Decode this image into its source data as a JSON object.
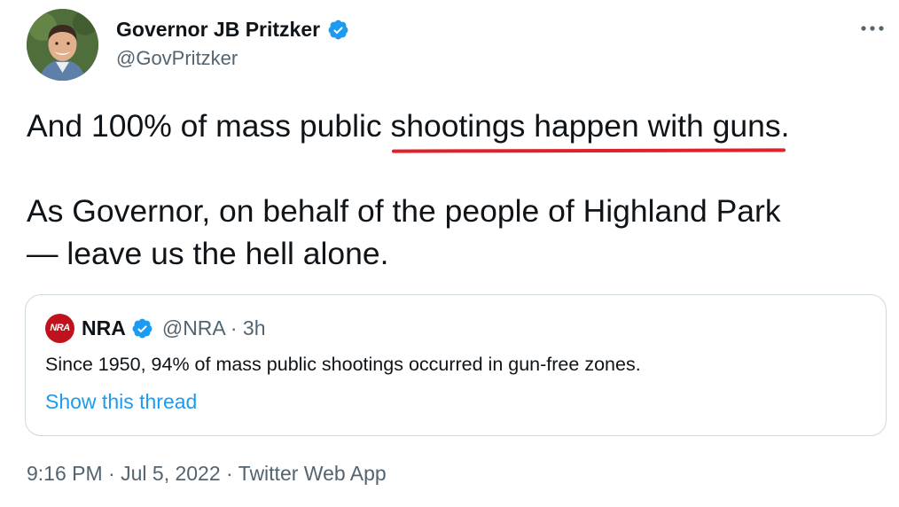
{
  "author": {
    "display_name": "Governor JB Pritzker",
    "handle": "@GovPritzker",
    "verified_icon": "verified-badge-icon"
  },
  "tweet": {
    "line1_before": "And 100% of mass public ",
    "line1_underlined": "shootings happen with guns",
    "line1_after": ".",
    "line2": "As Governor, on behalf of the people of Highland Park",
    "line3": "— leave us the hell alone.",
    "underline_color": "#e0202a"
  },
  "quoted_tweet": {
    "logo_text": "NRA",
    "display_name": "NRA",
    "meta": "@NRA · 3h",
    "text": "Since 1950, 94% of mass public shootings occurred in gun-free zones.",
    "show_thread": "Show this thread"
  },
  "footer": {
    "time": "9:16 PM",
    "separator1": " · ",
    "date": "Jul 5, 2022",
    "separator2": " · ",
    "source": "Twitter Web App"
  },
  "colors": {
    "text": "#0f1419",
    "secondary": "#536471",
    "link": "#1d9bf0",
    "verified": "#1d9bf0",
    "border": "#cfd9de",
    "nra_red": "#c0121c"
  }
}
